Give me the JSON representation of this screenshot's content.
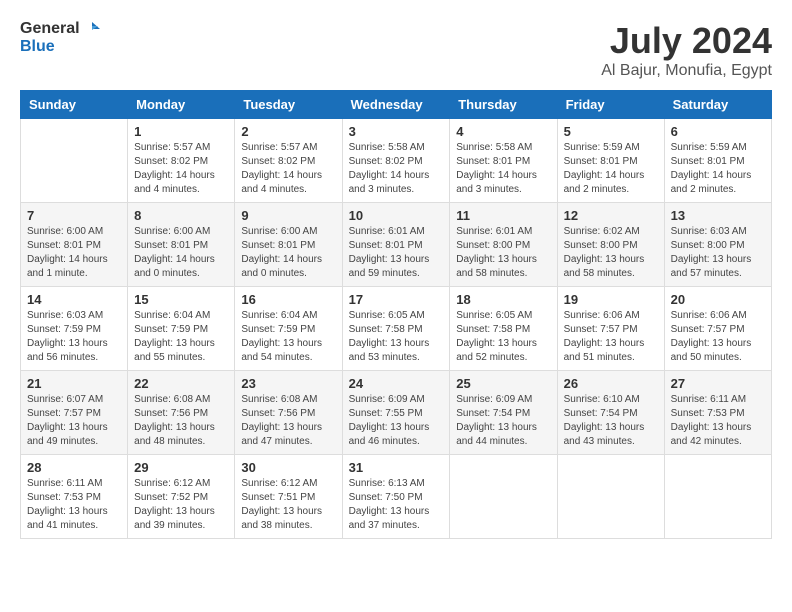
{
  "header": {
    "logo_general": "General",
    "logo_blue": "Blue",
    "month_year": "July 2024",
    "location": "Al Bajur, Monufia, Egypt"
  },
  "days_of_week": [
    "Sunday",
    "Monday",
    "Tuesday",
    "Wednesday",
    "Thursday",
    "Friday",
    "Saturday"
  ],
  "weeks": [
    [
      {
        "day": "",
        "sunrise": "",
        "sunset": "",
        "daylight": ""
      },
      {
        "day": "1",
        "sunrise": "Sunrise: 5:57 AM",
        "sunset": "Sunset: 8:02 PM",
        "daylight": "Daylight: 14 hours and 4 minutes."
      },
      {
        "day": "2",
        "sunrise": "Sunrise: 5:57 AM",
        "sunset": "Sunset: 8:02 PM",
        "daylight": "Daylight: 14 hours and 4 minutes."
      },
      {
        "day": "3",
        "sunrise": "Sunrise: 5:58 AM",
        "sunset": "Sunset: 8:02 PM",
        "daylight": "Daylight: 14 hours and 3 minutes."
      },
      {
        "day": "4",
        "sunrise": "Sunrise: 5:58 AM",
        "sunset": "Sunset: 8:01 PM",
        "daylight": "Daylight: 14 hours and 3 minutes."
      },
      {
        "day": "5",
        "sunrise": "Sunrise: 5:59 AM",
        "sunset": "Sunset: 8:01 PM",
        "daylight": "Daylight: 14 hours and 2 minutes."
      },
      {
        "day": "6",
        "sunrise": "Sunrise: 5:59 AM",
        "sunset": "Sunset: 8:01 PM",
        "daylight": "Daylight: 14 hours and 2 minutes."
      }
    ],
    [
      {
        "day": "7",
        "sunrise": "Sunrise: 6:00 AM",
        "sunset": "Sunset: 8:01 PM",
        "daylight": "Daylight: 14 hours and 1 minute."
      },
      {
        "day": "8",
        "sunrise": "Sunrise: 6:00 AM",
        "sunset": "Sunset: 8:01 PM",
        "daylight": "Daylight: 14 hours and 0 minutes."
      },
      {
        "day": "9",
        "sunrise": "Sunrise: 6:00 AM",
        "sunset": "Sunset: 8:01 PM",
        "daylight": "Daylight: 14 hours and 0 minutes."
      },
      {
        "day": "10",
        "sunrise": "Sunrise: 6:01 AM",
        "sunset": "Sunset: 8:01 PM",
        "daylight": "Daylight: 13 hours and 59 minutes."
      },
      {
        "day": "11",
        "sunrise": "Sunrise: 6:01 AM",
        "sunset": "Sunset: 8:00 PM",
        "daylight": "Daylight: 13 hours and 58 minutes."
      },
      {
        "day": "12",
        "sunrise": "Sunrise: 6:02 AM",
        "sunset": "Sunset: 8:00 PM",
        "daylight": "Daylight: 13 hours and 58 minutes."
      },
      {
        "day": "13",
        "sunrise": "Sunrise: 6:03 AM",
        "sunset": "Sunset: 8:00 PM",
        "daylight": "Daylight: 13 hours and 57 minutes."
      }
    ],
    [
      {
        "day": "14",
        "sunrise": "Sunrise: 6:03 AM",
        "sunset": "Sunset: 7:59 PM",
        "daylight": "Daylight: 13 hours and 56 minutes."
      },
      {
        "day": "15",
        "sunrise": "Sunrise: 6:04 AM",
        "sunset": "Sunset: 7:59 PM",
        "daylight": "Daylight: 13 hours and 55 minutes."
      },
      {
        "day": "16",
        "sunrise": "Sunrise: 6:04 AM",
        "sunset": "Sunset: 7:59 PM",
        "daylight": "Daylight: 13 hours and 54 minutes."
      },
      {
        "day": "17",
        "sunrise": "Sunrise: 6:05 AM",
        "sunset": "Sunset: 7:58 PM",
        "daylight": "Daylight: 13 hours and 53 minutes."
      },
      {
        "day": "18",
        "sunrise": "Sunrise: 6:05 AM",
        "sunset": "Sunset: 7:58 PM",
        "daylight": "Daylight: 13 hours and 52 minutes."
      },
      {
        "day": "19",
        "sunrise": "Sunrise: 6:06 AM",
        "sunset": "Sunset: 7:57 PM",
        "daylight": "Daylight: 13 hours and 51 minutes."
      },
      {
        "day": "20",
        "sunrise": "Sunrise: 6:06 AM",
        "sunset": "Sunset: 7:57 PM",
        "daylight": "Daylight: 13 hours and 50 minutes."
      }
    ],
    [
      {
        "day": "21",
        "sunrise": "Sunrise: 6:07 AM",
        "sunset": "Sunset: 7:57 PM",
        "daylight": "Daylight: 13 hours and 49 minutes."
      },
      {
        "day": "22",
        "sunrise": "Sunrise: 6:08 AM",
        "sunset": "Sunset: 7:56 PM",
        "daylight": "Daylight: 13 hours and 48 minutes."
      },
      {
        "day": "23",
        "sunrise": "Sunrise: 6:08 AM",
        "sunset": "Sunset: 7:56 PM",
        "daylight": "Daylight: 13 hours and 47 minutes."
      },
      {
        "day": "24",
        "sunrise": "Sunrise: 6:09 AM",
        "sunset": "Sunset: 7:55 PM",
        "daylight": "Daylight: 13 hours and 46 minutes."
      },
      {
        "day": "25",
        "sunrise": "Sunrise: 6:09 AM",
        "sunset": "Sunset: 7:54 PM",
        "daylight": "Daylight: 13 hours and 44 minutes."
      },
      {
        "day": "26",
        "sunrise": "Sunrise: 6:10 AM",
        "sunset": "Sunset: 7:54 PM",
        "daylight": "Daylight: 13 hours and 43 minutes."
      },
      {
        "day": "27",
        "sunrise": "Sunrise: 6:11 AM",
        "sunset": "Sunset: 7:53 PM",
        "daylight": "Daylight: 13 hours and 42 minutes."
      }
    ],
    [
      {
        "day": "28",
        "sunrise": "Sunrise: 6:11 AM",
        "sunset": "Sunset: 7:53 PM",
        "daylight": "Daylight: 13 hours and 41 minutes."
      },
      {
        "day": "29",
        "sunrise": "Sunrise: 6:12 AM",
        "sunset": "Sunset: 7:52 PM",
        "daylight": "Daylight: 13 hours and 39 minutes."
      },
      {
        "day": "30",
        "sunrise": "Sunrise: 6:12 AM",
        "sunset": "Sunset: 7:51 PM",
        "daylight": "Daylight: 13 hours and 38 minutes."
      },
      {
        "day": "31",
        "sunrise": "Sunrise: 6:13 AM",
        "sunset": "Sunset: 7:50 PM",
        "daylight": "Daylight: 13 hours and 37 minutes."
      },
      {
        "day": "",
        "sunrise": "",
        "sunset": "",
        "daylight": ""
      },
      {
        "day": "",
        "sunrise": "",
        "sunset": "",
        "daylight": ""
      },
      {
        "day": "",
        "sunrise": "",
        "sunset": "",
        "daylight": ""
      }
    ]
  ]
}
